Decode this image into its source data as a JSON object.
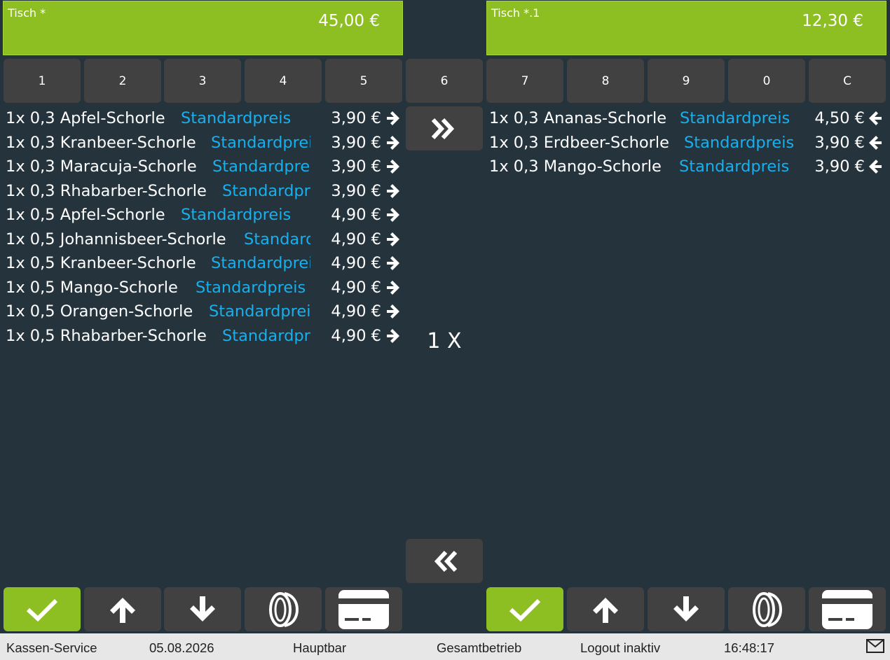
{
  "left": {
    "table_label": "Tisch *",
    "total": "45,00 €",
    "items": [
      {
        "name": "1x 0,3 Apfel-Schorle",
        "price_label": "Standardpreis",
        "price": "3,90 €"
      },
      {
        "name": "1x 0,3 Kranbeer-Schorle",
        "price_label": "Standardpreis",
        "price": "3,90 €"
      },
      {
        "name": "1x 0,3 Maracuja-Schorle",
        "price_label": "Standardpreis",
        "price": "3,90 €"
      },
      {
        "name": "1x 0,3 Rhabarber-Schorle",
        "price_label": "Standardpreis",
        "price": "3,90 €"
      },
      {
        "name": "1x 0,5 Apfel-Schorle",
        "price_label": "Standardpreis",
        "price": "4,90 €"
      },
      {
        "name": "1x 0,5 Johannisbeer-Schorle",
        "price_label": "Standardpreis",
        "price": "4,90 €"
      },
      {
        "name": "1x 0,5 Kranbeer-Schorle",
        "price_label": "Standardpreis",
        "price": "4,90 €"
      },
      {
        "name": "1x 0,5 Mango-Schorle",
        "price_label": "Standardpreis",
        "price": "4,90 €"
      },
      {
        "name": "1x 0,5 Orangen-Schorle",
        "price_label": "Standardpreis",
        "price": "4,90 €"
      },
      {
        "name": "1x 0,5 Rhabarber-Schorle",
        "price_label": "Standardpreis",
        "price": "4,90 €"
      }
    ]
  },
  "right": {
    "table_label": "Tisch *.1",
    "total": "12,30 €",
    "items": [
      {
        "name": "1x 0,3 Ananas-Schorle",
        "price_label": "Standardpreis",
        "price": "4,50 €"
      },
      {
        "name": "1x 0,3 Erdbeer-Schorle",
        "price_label": "Standardpreis",
        "price": "3,90 €"
      },
      {
        "name": "1x 0,3 Mango-Schorle",
        "price_label": "Standardpreis",
        "price": "3,90 €"
      }
    ]
  },
  "keypad": [
    "1",
    "2",
    "3",
    "4",
    "5",
    "6",
    "7",
    "8",
    "9",
    "0",
    "C"
  ],
  "quantity": "1 X",
  "status_bar": {
    "user": "Kassen-Service",
    "date": "05.08.2026",
    "location": "Hauptbar",
    "mode": "Gesamtbetrieb",
    "logout": "Logout inaktiv",
    "time": "16:48:17"
  },
  "icons": {
    "move_all_right": "double-chevron-right-icon",
    "move_all_left": "double-chevron-left-icon",
    "move_item_right": "arrow-right-icon",
    "move_item_left": "arrow-left-icon",
    "confirm": "checkmark-icon",
    "up": "arrow-up-icon",
    "down": "arrow-down-icon",
    "cash": "coin-icon",
    "card": "credit-card-icon",
    "mail": "mail-icon"
  },
  "colors": {
    "accent": "#8ebf22",
    "background": "#25333c",
    "button": "#414141",
    "price_label": "#17b0ef",
    "status_bar": "#e7e7e7"
  }
}
